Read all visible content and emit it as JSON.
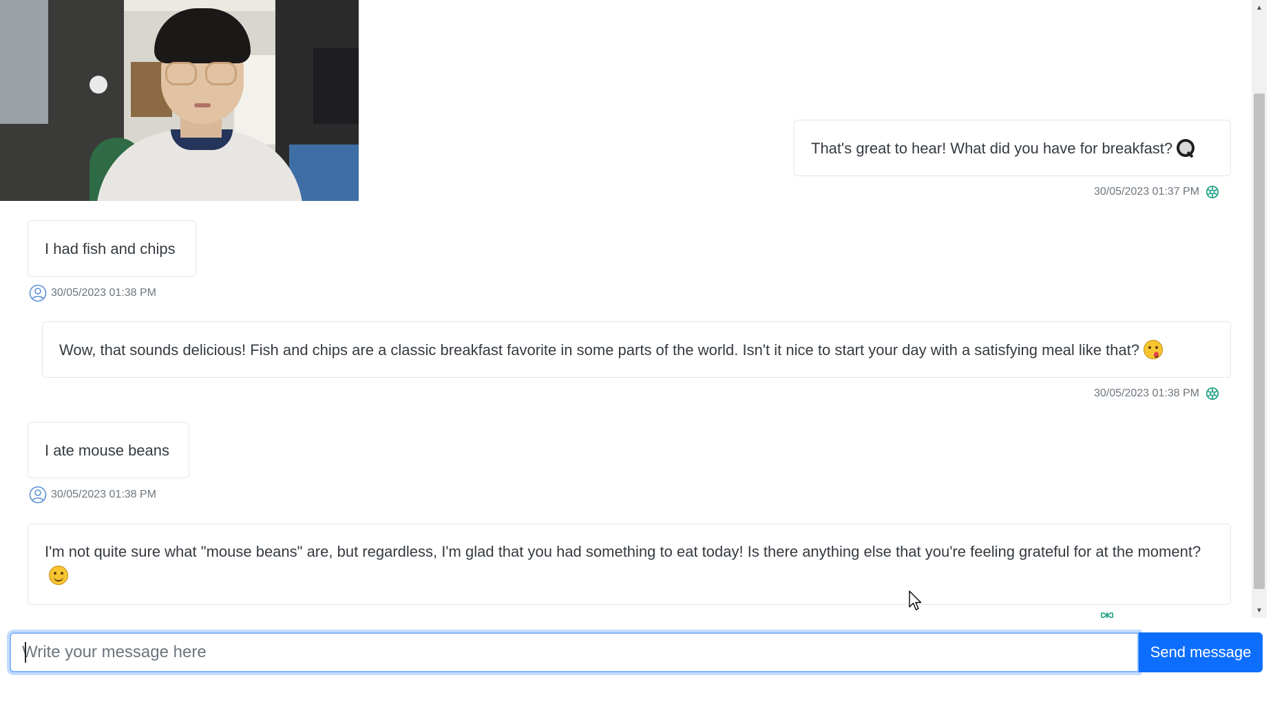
{
  "messages": [
    {
      "sender": "bot",
      "text": "That's great to hear! What did you have for breakfast?",
      "trailing_icon": "magnifying-glass-icon",
      "timestamp": "30/05/2023 01:37 PM"
    },
    {
      "sender": "user",
      "text": "I had fish and chips",
      "timestamp": "30/05/2023 01:38 PM"
    },
    {
      "sender": "bot",
      "text": "Wow, that sounds delicious! Fish and chips are a classic breakfast favorite in some parts of the world. Isn't it nice to start your day with a satisfying meal like that?",
      "trailing_icon": "yum-face-emoji",
      "timestamp": "30/05/2023 01:38 PM"
    },
    {
      "sender": "user",
      "text": "I ate mouse beans",
      "timestamp": "30/05/2023 01:38 PM"
    },
    {
      "sender": "bot",
      "text": "I'm not quite sure what \"mouse beans\" are, but regardless, I'm glad that you had something to eat today! Is there anything else that you're feeling grateful for at the moment?",
      "trailing_icon": "smiling-face-emoji",
      "timestamp": ""
    }
  ],
  "composer": {
    "placeholder": "Write your message here",
    "value": "",
    "send_label": "Send message"
  },
  "icons": {
    "bot": "openai-logo-icon",
    "user": "user-avatar-icon",
    "video": "webcam-video-feed"
  },
  "colors": {
    "accent": "#0d6efd",
    "focus_ring": "#86b7fe",
    "bot_icon": "#2aa58b",
    "user_icon": "#5b8fd6",
    "timestamp": "#6c757d"
  }
}
